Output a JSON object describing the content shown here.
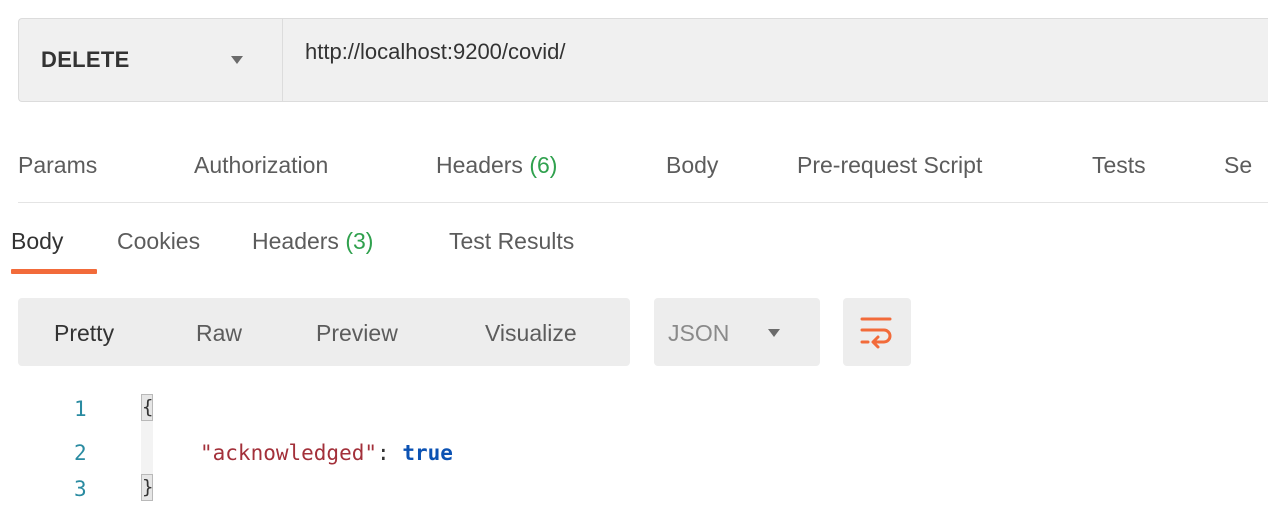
{
  "request": {
    "method": "DELETE",
    "url": "http://localhost:9200/covid/"
  },
  "request_tabs": [
    {
      "label": "Params",
      "count": null
    },
    {
      "label": "Authorization",
      "count": null
    },
    {
      "label": "Headers",
      "count": "(6)"
    },
    {
      "label": "Body",
      "count": null
    },
    {
      "label": "Pre-request Script",
      "count": null
    },
    {
      "label": "Tests",
      "count": null
    },
    {
      "label": "Se",
      "count": null
    }
  ],
  "response_tabs": [
    {
      "label": "Body",
      "count": null,
      "active": true
    },
    {
      "label": "Cookies",
      "count": null
    },
    {
      "label": "Headers",
      "count": "(3)"
    },
    {
      "label": "Test Results",
      "count": null
    }
  ],
  "view_modes": [
    "Pretty",
    "Raw",
    "Preview",
    "Visualize"
  ],
  "selected_view_mode": "Pretty",
  "format": "JSON",
  "wrap_icon": "text-wrap-icon",
  "code_lines": [
    {
      "number": "1",
      "text": "{"
    },
    {
      "number": "2",
      "key": "\"acknowledged\"",
      "colon": ": ",
      "value": "true"
    },
    {
      "number": "3",
      "text": "}"
    }
  ],
  "colors": {
    "accent": "#f26b3a",
    "count_green": "#30a14e",
    "json_key": "#a3303a",
    "json_boolean": "#0b52b3",
    "line_number": "#2a8ba1"
  }
}
